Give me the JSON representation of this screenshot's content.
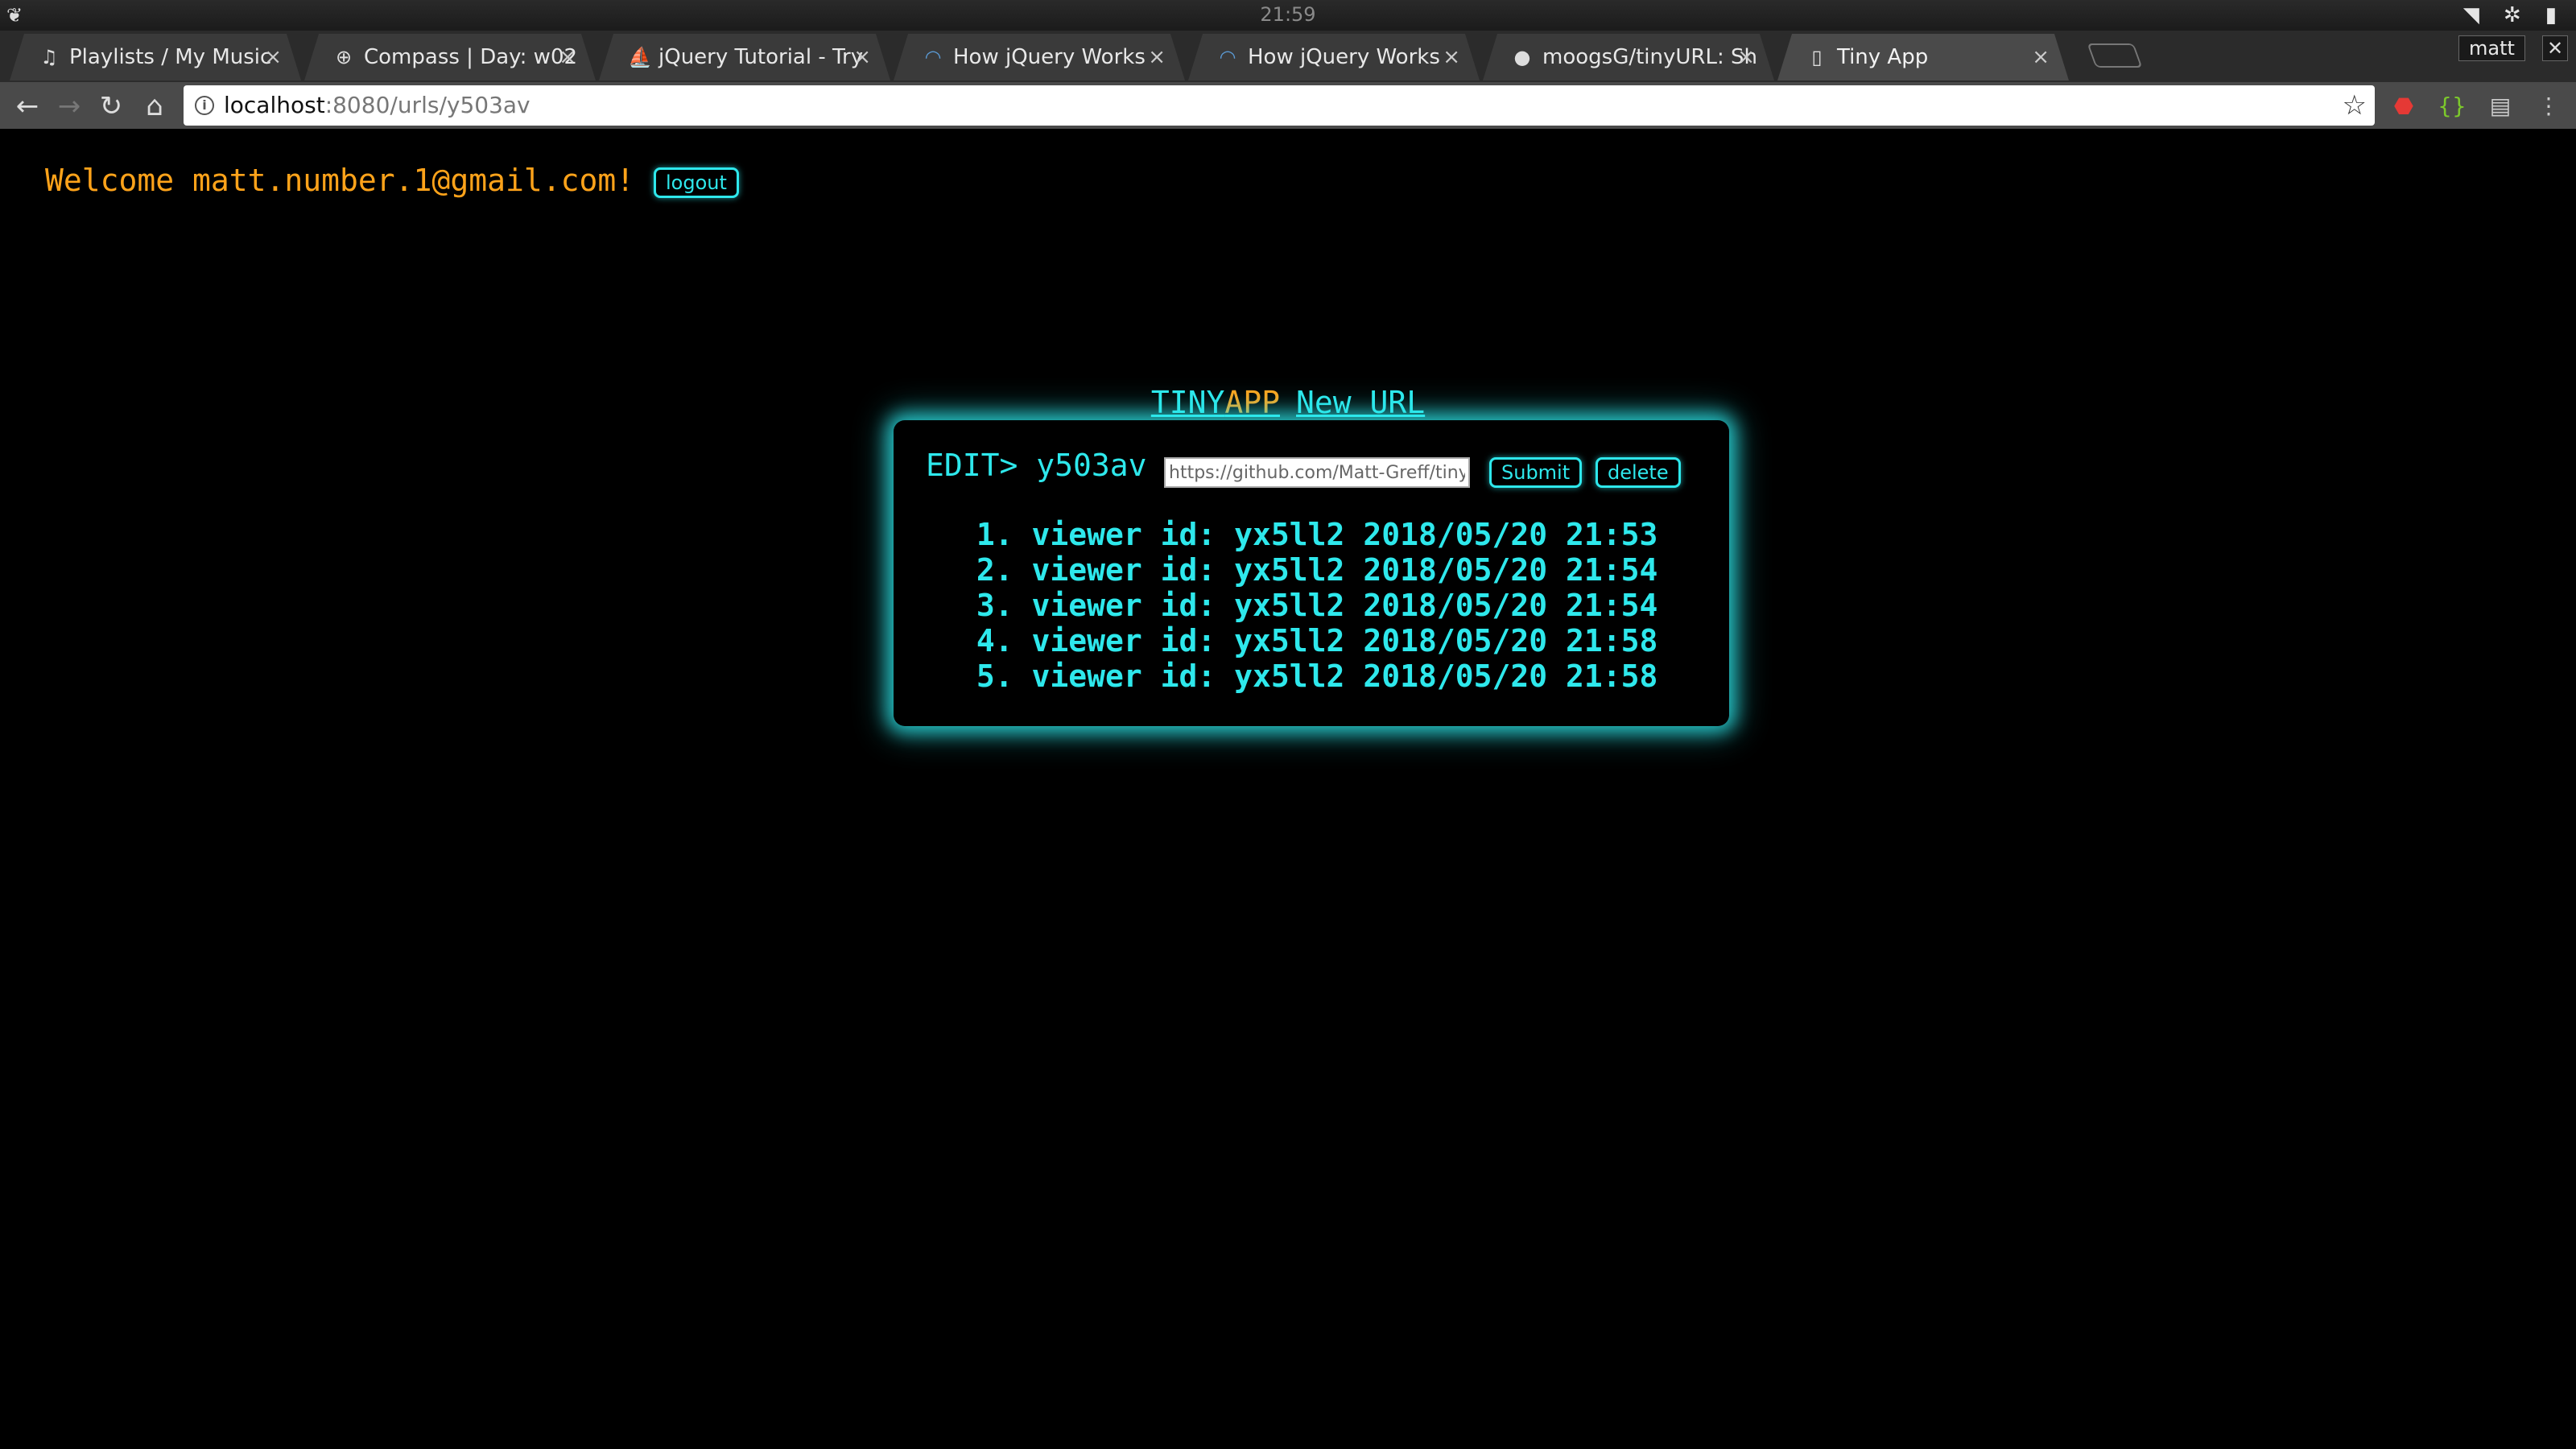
{
  "os": {
    "clock": "21:59",
    "profile": "matt",
    "close_glyph": "✕"
  },
  "tabs": [
    {
      "title": "Playlists / My  Music",
      "icon": "music-icon",
      "active": false
    },
    {
      "title": "Compass | Day: w02",
      "icon": "compass-icon",
      "active": false
    },
    {
      "title": "jQuery  Tutorial - Try",
      "icon": "jquery-icon",
      "active": false
    },
    {
      "title": "How  jQuery  Works",
      "icon": "jquery-icon",
      "active": false
    },
    {
      "title": "How  jQuery  Works",
      "icon": "jquery-icon",
      "active": false
    },
    {
      "title": "moogsG/tinyURL: Sh",
      "icon": "github-icon",
      "active": false
    },
    {
      "title": "Tiny  App",
      "icon": "page-icon",
      "active": true
    }
  ],
  "address": {
    "host": "localhost",
    "path": ":8080/urls/y503av"
  },
  "page": {
    "welcome": "Welcome matt.number.1@gmail.com!",
    "logout_label": "logout",
    "title_part1": "TINY",
    "title_part2": "APP",
    "title_part3": "New URL",
    "edit_label": "EDIT> y503av",
    "url_value": "https://github.com/Matt-Greff/tiny-",
    "submit_label": "Submit",
    "delete_label": "delete",
    "viewers": [
      " 1. viewer id: yx5ll2 2018/05/20 21:53",
      " 2. viewer id: yx5ll2 2018/05/20 21:54",
      " 3. viewer id: yx5ll2 2018/05/20 21:54",
      " 4. viewer id: yx5ll2 2018/05/20 21:58",
      " 5. viewer id: yx5ll2 2018/05/20 21:58"
    ]
  },
  "colors": {
    "accent_cyan": "#2ee8ec",
    "accent_orange": "#ffa31a",
    "background": "#000000"
  }
}
